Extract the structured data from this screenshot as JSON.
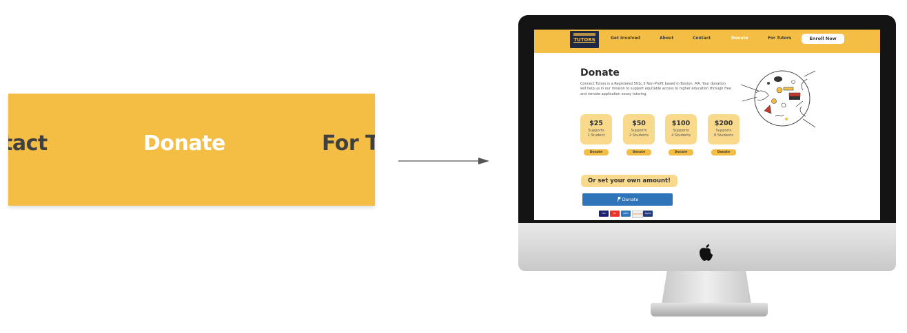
{
  "zoom": {
    "items": [
      "tact",
      "Donate",
      "For T"
    ],
    "active_item": "Donate"
  },
  "site": {
    "logo": "TUTORS",
    "nav": [
      "Get Involved",
      "About",
      "Contact",
      "Donate",
      "For Tutors"
    ],
    "active_nav": "Donate",
    "enroll": "Enroll Now"
  },
  "page": {
    "title": "Donate",
    "description": "Connect Tutors is a Registered 501c.3 Non-Profit based in Boston, MA. Your donation will help us in our mission to support equitable access to higher education through free and remote application essay tutoring.",
    "tiers": [
      {
        "amount": "$25",
        "line1": "Supports",
        "line2": "1 Student",
        "button": "Donate"
      },
      {
        "amount": "$50",
        "line1": "Supports",
        "line2": "2 Students",
        "button": "Donate"
      },
      {
        "amount": "$100",
        "line1": "Supports",
        "line2": "4 Students",
        "button": "Donate"
      },
      {
        "amount": "$200",
        "line1": "Supports",
        "line2": "8 Students",
        "button": "Donate"
      }
    ],
    "custom_amount": "Or set your own amount!",
    "paypal_button": "Donate",
    "payment_methods": [
      "VISA",
      "MC",
      "AMEX",
      "DISCOVER",
      "PayPal"
    ]
  },
  "colors": {
    "brand_yellow": "#f4bd44",
    "light_yellow": "#f9d98b",
    "paypal_blue": "#2f74b9",
    "navy": "#1f2a44"
  },
  "icons": [
    "arrow-right-icon",
    "apple-logo-icon",
    "paypal-icon",
    "donation-illustration"
  ]
}
